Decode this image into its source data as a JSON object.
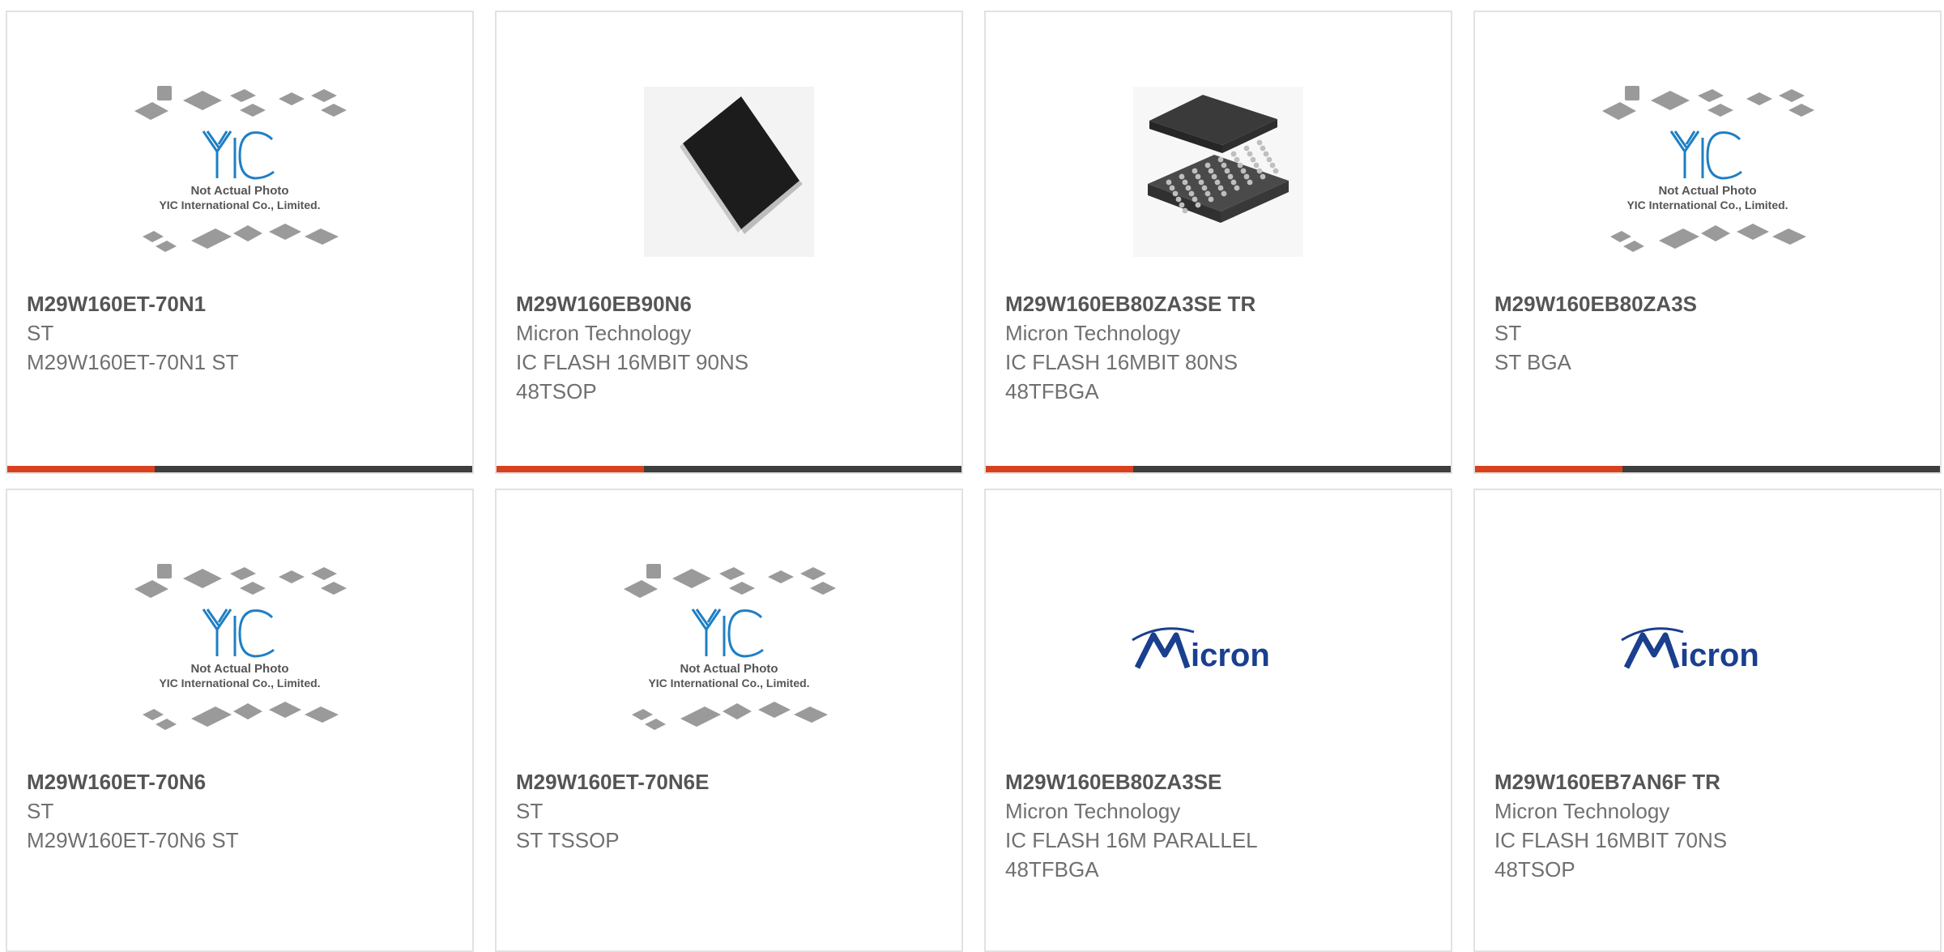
{
  "cards": [
    {
      "part_number": "M29W160ET-70N1",
      "manufacturer": "ST",
      "description": "M29W160ET-70N1 ST",
      "image": "not-actual-photo-placeholder"
    },
    {
      "part_number": "M29W160EB90N6",
      "manufacturer": "Micron Technology",
      "description": "IC FLASH 16MBIT 90NS 48TSOP",
      "image": "tsop-chip-photo"
    },
    {
      "part_number": "M29W160EB80ZA3SE TR",
      "manufacturer": "Micron Technology",
      "description": "IC FLASH 16MBIT 80NS 48TFBGA",
      "image": "bga-chip-photo"
    },
    {
      "part_number": "M29W160EB80ZA3S",
      "manufacturer": "ST",
      "description": "ST BGA",
      "image": "not-actual-photo-placeholder"
    },
    {
      "part_number": "M29W160ET-70N6",
      "manufacturer": "ST",
      "description": "M29W160ET-70N6 ST",
      "image": "not-actual-photo-placeholder"
    },
    {
      "part_number": "M29W160ET-70N6E",
      "manufacturer": "ST",
      "description": "ST TSSOP",
      "image": "not-actual-photo-placeholder"
    },
    {
      "part_number": "M29W160EB80ZA3SE",
      "manufacturer": "Micron Technology",
      "description": "IC FLASH 16M PARALLEL 48TFBGA",
      "image": "micron-logo"
    },
    {
      "part_number": "M29W160EB7AN6F TR",
      "manufacturer": "Micron Technology",
      "description": "IC FLASH 16MBIT 70NS 48TSOP",
      "image": "micron-logo"
    }
  ],
  "placeholder": {
    "brand": "YIC",
    "line1": "Not Actual Photo",
    "line2": "YIC International Co., Limited."
  },
  "micron_logo_text": "Micron",
  "colors": {
    "accent": "#d9411e",
    "bar": "#3e3e3e",
    "yic_blue": "#1f7fc4",
    "micron_blue": "#1a3f8f"
  }
}
